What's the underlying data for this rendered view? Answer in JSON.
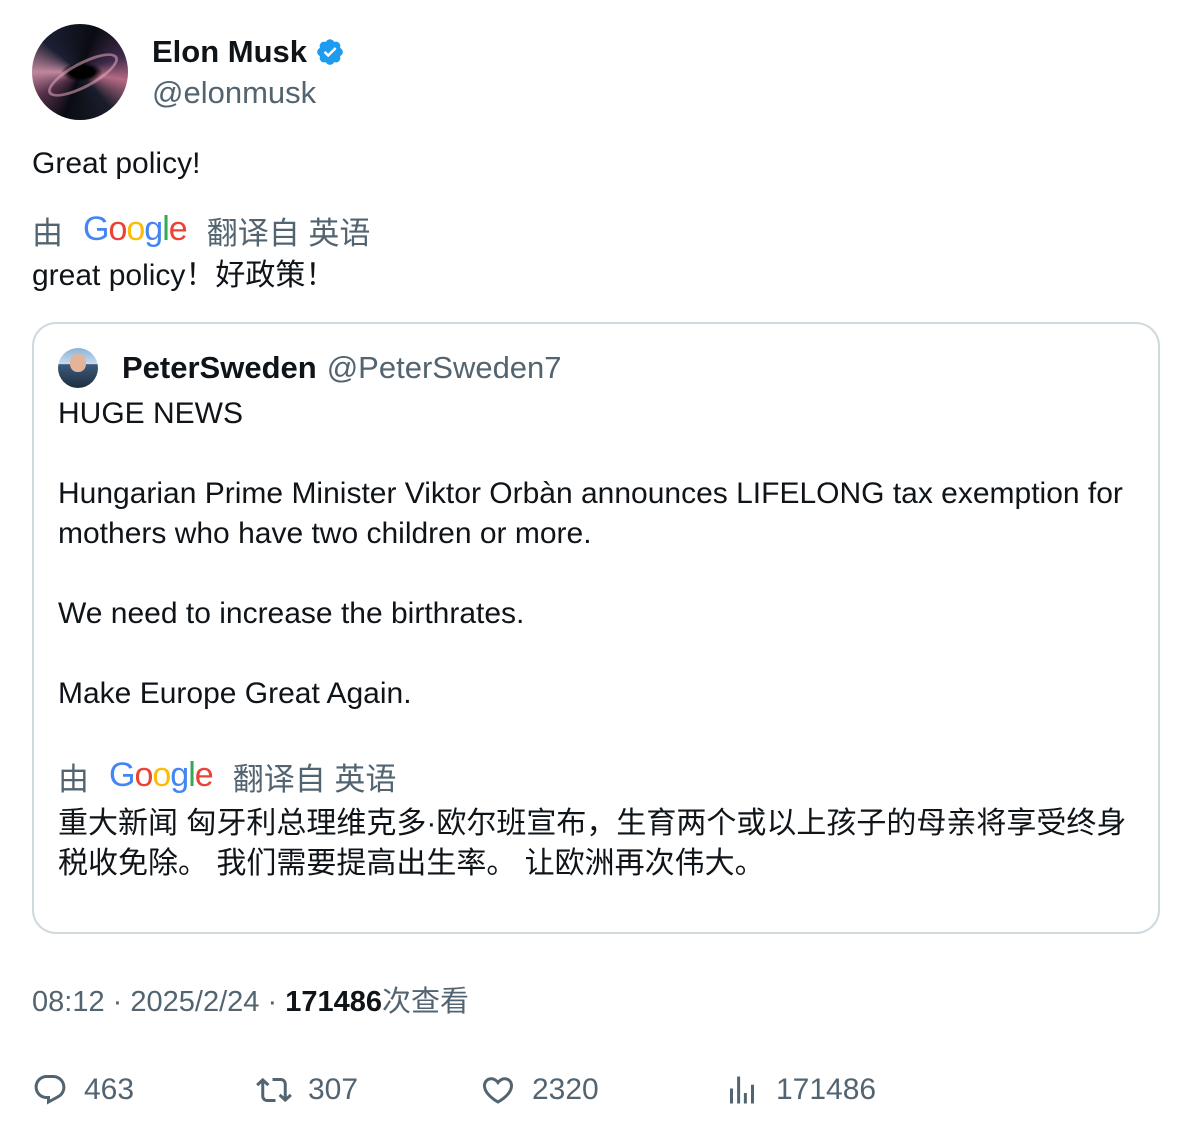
{
  "author": {
    "display_name": "Elon Musk",
    "handle": "@elonmusk",
    "avatar_icon": "black-hole-avatar",
    "verified_icon": "verified-badge-icon",
    "verified_color": "#1d9bf0"
  },
  "tweet": {
    "text": "Great policy!",
    "translate_prefix": "由",
    "translate_suffix": "翻译自 英语",
    "translated_text": "great policy！好政策！"
  },
  "google_logo": {
    "letters": [
      "G",
      "o",
      "o",
      "g",
      "l",
      "e"
    ],
    "colors": [
      "#4285F4",
      "#EA4335",
      "#FBBC05",
      "#4285F4",
      "#34A853",
      "#EA4335"
    ]
  },
  "quote": {
    "display_name": "PeterSweden",
    "handle": "@PeterSweden7",
    "line1": "HUGE NEWS",
    "line2": "Hungarian Prime Minister Viktor Orbàn announces LIFELONG tax exemption for mothers who have two children or more.",
    "line3": "We need to increase the birthrates.",
    "line4": "Make Europe Great Again.",
    "translate_prefix": "由",
    "translate_suffix": "翻译自 英语",
    "translated_text": "重大新闻 匈牙利总理维克多·欧尔班宣布，生育两个或以上孩子的母亲将享受终身税收免除。 我们需要提高出生率。 让欧洲再次伟大。"
  },
  "meta": {
    "time": "08:12",
    "separator": "·",
    "date": "2025/2/24",
    "views_count": "171486",
    "views_label": "次查看"
  },
  "actions": {
    "replies": "463",
    "retweets": "307",
    "likes": "2320",
    "views": "171486"
  }
}
